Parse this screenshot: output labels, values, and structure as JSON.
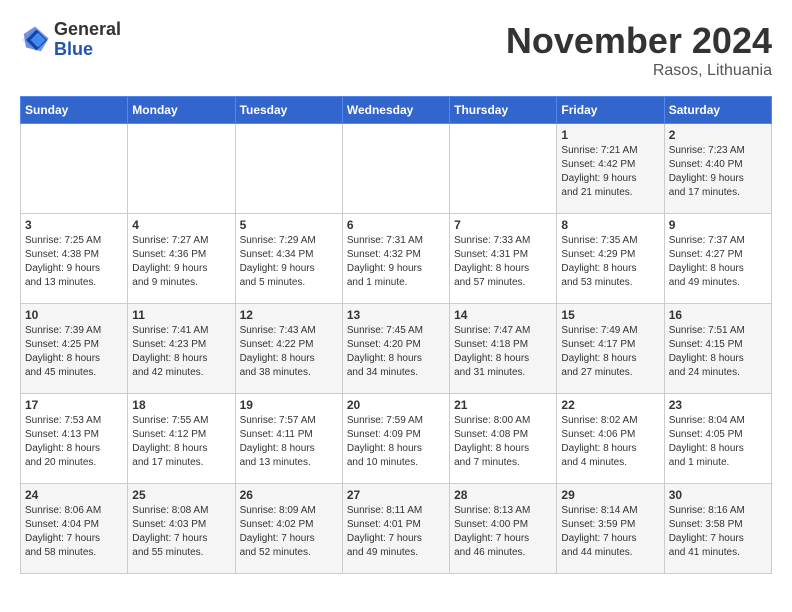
{
  "header": {
    "logo_line1": "General",
    "logo_line2": "Blue",
    "month": "November 2024",
    "location": "Rasos, Lithuania"
  },
  "days_of_week": [
    "Sunday",
    "Monday",
    "Tuesday",
    "Wednesday",
    "Thursday",
    "Friday",
    "Saturday"
  ],
  "weeks": [
    [
      {
        "day": "",
        "info": ""
      },
      {
        "day": "",
        "info": ""
      },
      {
        "day": "",
        "info": ""
      },
      {
        "day": "",
        "info": ""
      },
      {
        "day": "",
        "info": ""
      },
      {
        "day": "1",
        "info": "Sunrise: 7:21 AM\nSunset: 4:42 PM\nDaylight: 9 hours\nand 21 minutes."
      },
      {
        "day": "2",
        "info": "Sunrise: 7:23 AM\nSunset: 4:40 PM\nDaylight: 9 hours\nand 17 minutes."
      }
    ],
    [
      {
        "day": "3",
        "info": "Sunrise: 7:25 AM\nSunset: 4:38 PM\nDaylight: 9 hours\nand 13 minutes."
      },
      {
        "day": "4",
        "info": "Sunrise: 7:27 AM\nSunset: 4:36 PM\nDaylight: 9 hours\nand 9 minutes."
      },
      {
        "day": "5",
        "info": "Sunrise: 7:29 AM\nSunset: 4:34 PM\nDaylight: 9 hours\nand 5 minutes."
      },
      {
        "day": "6",
        "info": "Sunrise: 7:31 AM\nSunset: 4:32 PM\nDaylight: 9 hours\nand 1 minute."
      },
      {
        "day": "7",
        "info": "Sunrise: 7:33 AM\nSunset: 4:31 PM\nDaylight: 8 hours\nand 57 minutes."
      },
      {
        "day": "8",
        "info": "Sunrise: 7:35 AM\nSunset: 4:29 PM\nDaylight: 8 hours\nand 53 minutes."
      },
      {
        "day": "9",
        "info": "Sunrise: 7:37 AM\nSunset: 4:27 PM\nDaylight: 8 hours\nand 49 minutes."
      }
    ],
    [
      {
        "day": "10",
        "info": "Sunrise: 7:39 AM\nSunset: 4:25 PM\nDaylight: 8 hours\nand 45 minutes."
      },
      {
        "day": "11",
        "info": "Sunrise: 7:41 AM\nSunset: 4:23 PM\nDaylight: 8 hours\nand 42 minutes."
      },
      {
        "day": "12",
        "info": "Sunrise: 7:43 AM\nSunset: 4:22 PM\nDaylight: 8 hours\nand 38 minutes."
      },
      {
        "day": "13",
        "info": "Sunrise: 7:45 AM\nSunset: 4:20 PM\nDaylight: 8 hours\nand 34 minutes."
      },
      {
        "day": "14",
        "info": "Sunrise: 7:47 AM\nSunset: 4:18 PM\nDaylight: 8 hours\nand 31 minutes."
      },
      {
        "day": "15",
        "info": "Sunrise: 7:49 AM\nSunset: 4:17 PM\nDaylight: 8 hours\nand 27 minutes."
      },
      {
        "day": "16",
        "info": "Sunrise: 7:51 AM\nSunset: 4:15 PM\nDaylight: 8 hours\nand 24 minutes."
      }
    ],
    [
      {
        "day": "17",
        "info": "Sunrise: 7:53 AM\nSunset: 4:13 PM\nDaylight: 8 hours\nand 20 minutes."
      },
      {
        "day": "18",
        "info": "Sunrise: 7:55 AM\nSunset: 4:12 PM\nDaylight: 8 hours\nand 17 minutes."
      },
      {
        "day": "19",
        "info": "Sunrise: 7:57 AM\nSunset: 4:11 PM\nDaylight: 8 hours\nand 13 minutes."
      },
      {
        "day": "20",
        "info": "Sunrise: 7:59 AM\nSunset: 4:09 PM\nDaylight: 8 hours\nand 10 minutes."
      },
      {
        "day": "21",
        "info": "Sunrise: 8:00 AM\nSunset: 4:08 PM\nDaylight: 8 hours\nand 7 minutes."
      },
      {
        "day": "22",
        "info": "Sunrise: 8:02 AM\nSunset: 4:06 PM\nDaylight: 8 hours\nand 4 minutes."
      },
      {
        "day": "23",
        "info": "Sunrise: 8:04 AM\nSunset: 4:05 PM\nDaylight: 8 hours\nand 1 minute."
      }
    ],
    [
      {
        "day": "24",
        "info": "Sunrise: 8:06 AM\nSunset: 4:04 PM\nDaylight: 7 hours\nand 58 minutes."
      },
      {
        "day": "25",
        "info": "Sunrise: 8:08 AM\nSunset: 4:03 PM\nDaylight: 7 hours\nand 55 minutes."
      },
      {
        "day": "26",
        "info": "Sunrise: 8:09 AM\nSunset: 4:02 PM\nDaylight: 7 hours\nand 52 minutes."
      },
      {
        "day": "27",
        "info": "Sunrise: 8:11 AM\nSunset: 4:01 PM\nDaylight: 7 hours\nand 49 minutes."
      },
      {
        "day": "28",
        "info": "Sunrise: 8:13 AM\nSunset: 4:00 PM\nDaylight: 7 hours\nand 46 minutes."
      },
      {
        "day": "29",
        "info": "Sunrise: 8:14 AM\nSunset: 3:59 PM\nDaylight: 7 hours\nand 44 minutes."
      },
      {
        "day": "30",
        "info": "Sunrise: 8:16 AM\nSunset: 3:58 PM\nDaylight: 7 hours\nand 41 minutes."
      }
    ]
  ]
}
